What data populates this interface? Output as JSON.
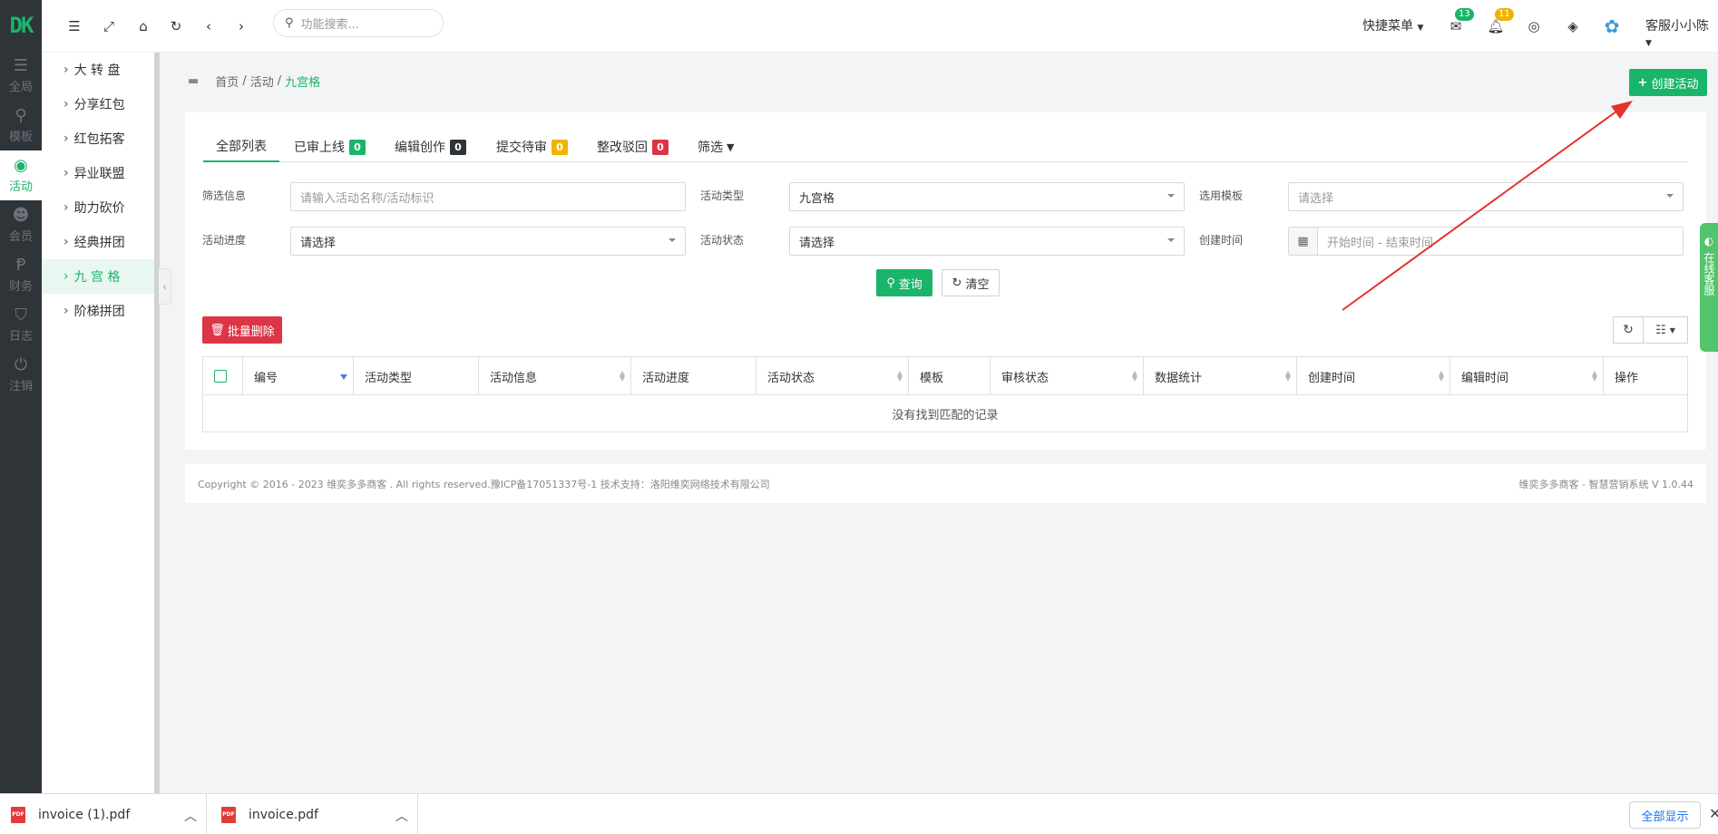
{
  "rail": {
    "logo": "DK",
    "items": [
      {
        "label": "全局",
        "icon": "sliders-icon"
      },
      {
        "label": "模板",
        "icon": "sitemap-icon"
      },
      {
        "label": "活动",
        "icon": "podcast-icon",
        "active": true
      },
      {
        "label": "会员",
        "icon": "users-icon"
      },
      {
        "label": "财务",
        "icon": "paypal-icon"
      },
      {
        "label": "日志",
        "icon": "shield-icon"
      },
      {
        "label": "注销",
        "icon": "power-icon"
      }
    ]
  },
  "sidebar": {
    "items": [
      {
        "label": "大 转 盘"
      },
      {
        "label": "分享红包"
      },
      {
        "label": "红包拓客"
      },
      {
        "label": "异业联盟"
      },
      {
        "label": "助力砍价"
      },
      {
        "label": "经典拼团"
      },
      {
        "label": "九 宫 格",
        "active": true
      },
      {
        "label": "阶梯拼团"
      }
    ]
  },
  "topbar": {
    "search_placeholder": "功能搜索...",
    "quick_menu": "快捷菜单",
    "mail_count": "13",
    "bell_count": "11",
    "user_name": "客服小小陈"
  },
  "breadcrumb": {
    "home": "首页",
    "sep1": "/",
    "parent": "活动",
    "sep2": "/",
    "current": "九宫格"
  },
  "create_button": "创建活动",
  "tabs": [
    {
      "label": "全部列表"
    },
    {
      "label": "已审上线",
      "count": "0",
      "color": "#1ab56b"
    },
    {
      "label": "编辑创作",
      "count": "0",
      "color": "#2f3439"
    },
    {
      "label": "提交待审",
      "count": "0",
      "color": "#f0b400"
    },
    {
      "label": "整改驳回",
      "count": "0",
      "color": "#dc3545"
    },
    {
      "label": "筛选"
    }
  ],
  "filters": {
    "info_label": "筛选信息",
    "info_placeholder": "请输入活动名称/活动标识",
    "type_label": "活动类型",
    "type_value": "九宫格",
    "template_label": "选用模板",
    "template_placeholder": "请选择",
    "progress_label": "活动进度",
    "progress_value": "请选择",
    "status_label": "活动状态",
    "status_value": "请选择",
    "created_label": "创建时间",
    "created_placeholder": "开始时间 - 结束时间"
  },
  "buttons": {
    "query": "查询",
    "clear": "清空",
    "batch_delete": "批量删除"
  },
  "table": {
    "columns": [
      "编号",
      "活动类型",
      "活动信息",
      "活动进度",
      "活动状态",
      "模板",
      "审核状态",
      "数据统计",
      "创建时间",
      "编辑时间",
      "操作"
    ],
    "empty_text": "没有找到匹配的记录"
  },
  "footer": {
    "copyright": "Copyright © 2016 - 2023 维奕多多商客 . All rights reserved.豫ICP备17051337号-1 技术支持：洛阳维奕网络技术有限公司",
    "version": "维奕多多商客 - 智慧营销系统 V 1.0.44"
  },
  "float_tab": "在线客服",
  "downloads": {
    "items": [
      {
        "name": "invoice (1).pdf"
      },
      {
        "name": "invoice.pdf"
      }
    ],
    "show_all": "全部显示"
  }
}
